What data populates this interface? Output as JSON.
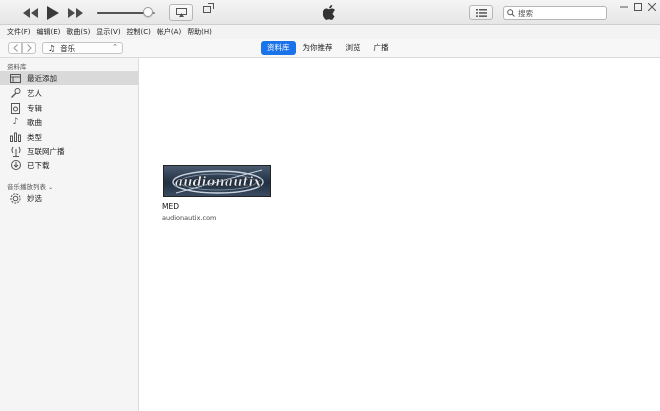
{
  "search": {
    "placeholder": "搜索"
  },
  "menu": [
    "文件(F)",
    "编辑(E)",
    "歌曲(S)",
    "显示(V)",
    "控制(C)",
    "帐户(A)",
    "帮助(H)"
  ],
  "media_picker": {
    "label": "音乐"
  },
  "tabs": [
    "资料库",
    "为你推荐",
    "浏览",
    "广播"
  ],
  "active_tab_index": 0,
  "player": {
    "volume_percent": 88
  },
  "sidebar": {
    "library_heading": "资料库",
    "library_items": [
      {
        "label": "最近添加",
        "icon": "recently-added-icon",
        "selected": true
      },
      {
        "label": "艺人",
        "icon": "microphone-icon",
        "selected": false
      },
      {
        "label": "专辑",
        "icon": "album-icon",
        "selected": false
      },
      {
        "label": "歌曲",
        "icon": "music-note-icon",
        "selected": false
      },
      {
        "label": "类型",
        "icon": "genres-icon",
        "selected": false
      },
      {
        "label": "互联网广播",
        "icon": "radio-antenna-icon",
        "selected": false
      },
      {
        "label": "已下载",
        "icon": "download-icon",
        "selected": false
      }
    ],
    "playlists_heading": "音乐播放列表",
    "playlist_items": [
      {
        "label": "妙选",
        "icon": "genius-icon"
      }
    ]
  },
  "album": {
    "artwork_text": "audionautix",
    "title": "MED",
    "subtitle": "audionautix.com"
  },
  "colors": {
    "accent": "#1a73e8",
    "selected_row": "#d9d9d9"
  }
}
